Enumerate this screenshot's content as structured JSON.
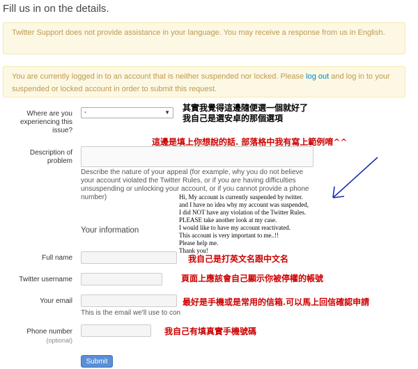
{
  "page_title": "Fill us in on the details.",
  "language_alert": "Twitter Support does not provide assistance in your language. You may receive a response from us in English.",
  "login_alert": {
    "before": "You are currently logged in to an account that is neither suspended nor locked. Please ",
    "link": "log out",
    "after": " and log in to your suspended or locked account in order to submit this request."
  },
  "form": {
    "where_label": "Where are you experiencing this issue?",
    "where_value": "-",
    "description_label": "Description of problem",
    "description_help": "Describe the nature of your appeal (for example, why you do not believe your account violated the Twitter Rules, or if you are having difficulties unsuspending or unlocking your account, or if you cannot provide a phone number)",
    "section_title": "Your information",
    "fullname_label": "Full name",
    "username_label": "Twitter username",
    "email_label": "Your email",
    "email_help": "This is the email we'll use to con",
    "phone_label": "Phone number",
    "phone_optional": "(optional)",
    "submit_label": "Submit"
  },
  "annotations": {
    "where_note": [
      "其實我覺得這邊隨便選一個就好了",
      "我自己是選安卓的那個選項"
    ],
    "description_note": "這邊是填上你想說的話. 部落格中我有寫上範例唷^^",
    "fullname_note": "我自己是打英文名跟中文名",
    "username_note": "頁面上應該會自己顯示你被停權的帳號",
    "email_note": "最好是手機或是常用的信箱.可以馬上回信確認申請",
    "phone_note": "我自己有填真實手機號碼",
    "example_letter": [
      "Hi,  My account is currently suspended by twitter.",
      "and I have no idea why my account was suspended,",
      "I did NOT have any violation of the Twitter Rules.",
      "PLEASE take another look at my case.",
      "I would like to have my account reactivated.",
      "This account is very important to me..!!",
      "Please help me.",
      "Thank you!"
    ]
  },
  "colors": {
    "alert_bg": "#fcf8e3",
    "alert_text": "#c09853",
    "link": "#0088cc",
    "annotation_red": "#cc0000",
    "arrow_blue": "#1a2db0",
    "submit_bg": "#5b8fd6"
  }
}
